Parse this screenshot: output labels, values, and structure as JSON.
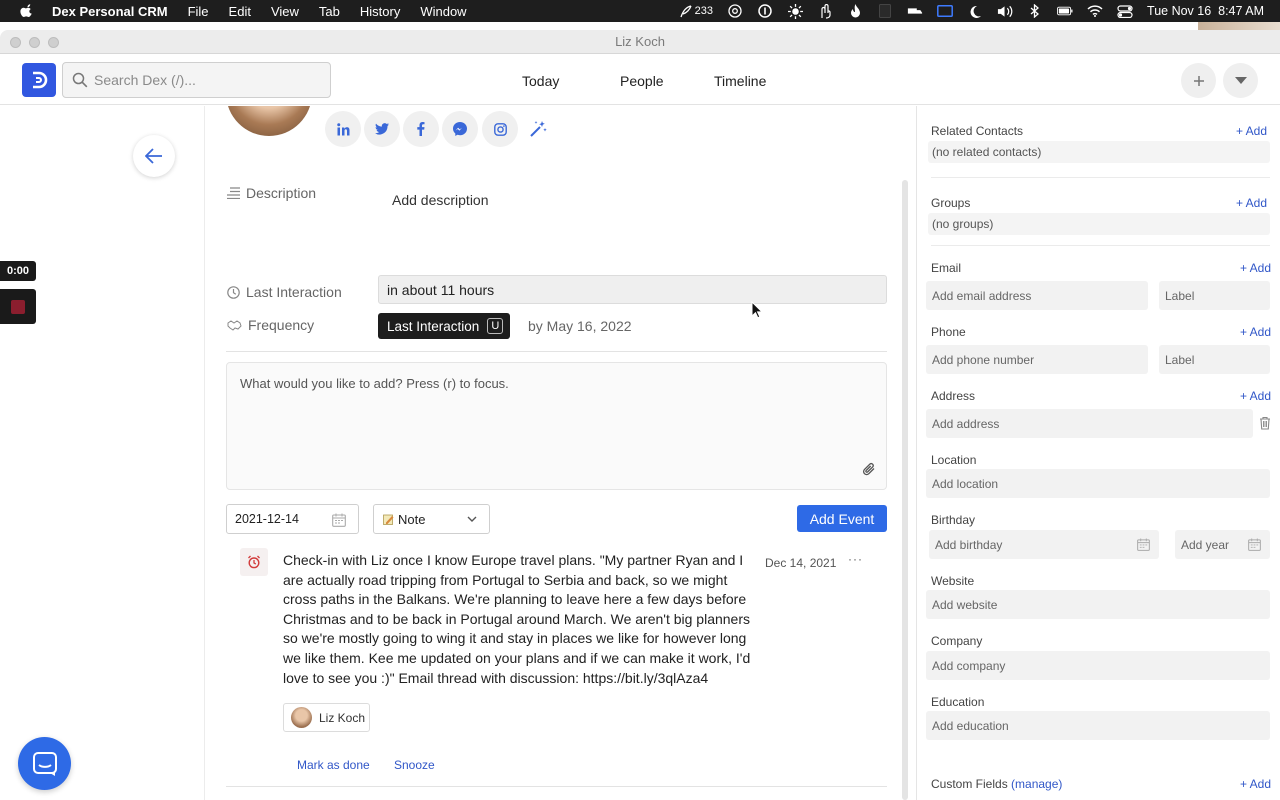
{
  "menubar": {
    "app_name": "Dex Personal CRM",
    "menus": [
      "File",
      "Edit",
      "View",
      "Tab",
      "History",
      "Window"
    ],
    "status": {
      "feather_count": "233",
      "datetime": "Tue Nov 16  8:47 AM"
    }
  },
  "window": {
    "title": "Liz Koch"
  },
  "header": {
    "search_placeholder": "Search Dex (/)...",
    "tabs": [
      "Today",
      "People",
      "Timeline"
    ]
  },
  "timer": "0:00",
  "profile": {
    "social": [
      "linkedin-icon",
      "twitter-icon",
      "facebook-icon",
      "messenger-icon",
      "instagram-icon"
    ],
    "description_label": "Description",
    "description_value": "Add description",
    "last_interaction_label": "Last Interaction",
    "last_interaction_value": "in about 11 hours",
    "tooltip_label": "Last Interaction",
    "tooltip_key": "U",
    "frequency_label": "Frequency",
    "frequency_date": "by May 16, 2022"
  },
  "composer": {
    "placeholder": "What would you like to add? Press (r) to focus.",
    "date": "2021-12-14",
    "type": "Note",
    "add_button": "Add Event"
  },
  "event": {
    "text": "Check-in with Liz once I know Europe travel plans. \"My partner Ryan and I are actually road tripping from Portugal to Serbia and back, so we might cross paths in the Balkans. We're planning to leave here a few days before Christmas and to be back in Portugal around March. We aren't big planners so we're mostly going to wing it and stay in places we like for however long we like them. Kee me updated on your plans and if we can make it work, I'd love to see you :)\" Email thread with discussion: https://bit.ly/3qlAza4",
    "date": "Dec 14, 2021",
    "more": "···",
    "contact": "Liz Koch",
    "mark_done": "Mark as done",
    "snooze": "Snooze"
  },
  "right_panel": {
    "add_label": "+ Add",
    "related_contacts": {
      "label": "Related Contacts",
      "value": "(no related contacts)"
    },
    "groups": {
      "label": "Groups",
      "value": "(no groups)"
    },
    "email": {
      "label": "Email",
      "placeholder": "Add email address",
      "label_placeholder": "Label"
    },
    "phone": {
      "label": "Phone",
      "placeholder": "Add phone number",
      "label_placeholder": "Label"
    },
    "address": {
      "label": "Address",
      "placeholder": "Add address"
    },
    "location": {
      "label": "Location",
      "placeholder": "Add location"
    },
    "birthday": {
      "label": "Birthday",
      "placeholder": "Add birthday",
      "year_placeholder": "Add year"
    },
    "website": {
      "label": "Website",
      "placeholder": "Add website"
    },
    "company": {
      "label": "Company",
      "placeholder": "Add company"
    },
    "education": {
      "label": "Education",
      "placeholder": "Add education"
    },
    "custom_fields": {
      "label": "Custom Fields",
      "manage": "(manage)"
    }
  },
  "colors": {
    "accent": "#2e6ae6",
    "link": "#3157c8",
    "logo": "#3157e0",
    "record": "#8b1e2e"
  }
}
